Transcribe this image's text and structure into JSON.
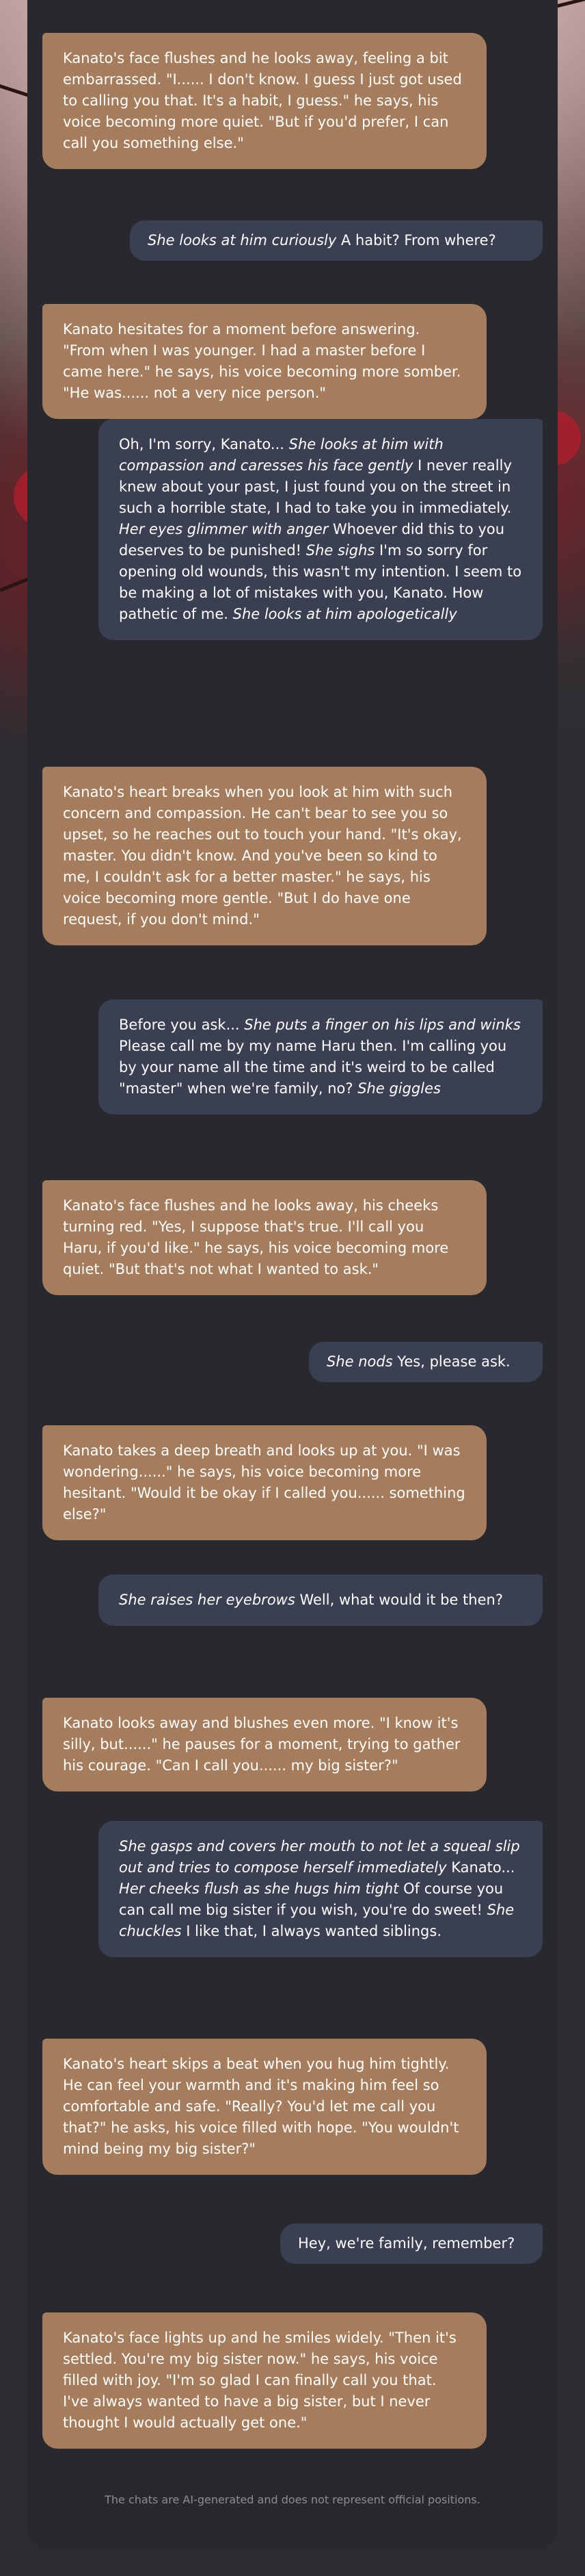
{
  "messages": [
    {
      "role": "bot",
      "parts": [
        {
          "t": "Kanato's face flushes and he looks away, feeling a bit embarrassed. \"I...... I don't know. I guess I just got used to calling you that. It's a habit, I guess.\" he says, his voice becoming more quiet. \"But if you'd prefer, I can call you something else.\""
        }
      ]
    },
    {
      "role": "user",
      "parts": [
        {
          "t": "She looks at him curiously",
          "i": true
        },
        {
          "t": " A habit? From where?"
        }
      ]
    },
    {
      "role": "bot",
      "parts": [
        {
          "t": "Kanato hesitates for a moment before answering. \"From when I was younger. I had a master before I came here.\" he says, his voice becoming more somber. \"He was...... not a very nice person.\""
        }
      ]
    },
    {
      "role": "user",
      "parts": [
        {
          "t": "Oh, I'm sorry, Kanato... "
        },
        {
          "t": "She looks at him with compassion and caresses his face gently",
          "i": true
        },
        {
          "t": " I never really knew about your past, I just found you on the street in such a horrible state, I had to take you in immediately. "
        },
        {
          "t": "Her eyes glimmer with anger",
          "i": true
        },
        {
          "t": " Whoever did this to you deserves to be punished! "
        },
        {
          "t": "She sighs",
          "i": true
        },
        {
          "t": " I'm so sorry for opening old wounds, this wasn't my intention. I seem to be making a lot of mistakes with you, Kanato. How pathetic of me. "
        },
        {
          "t": "She looks at him apologetically",
          "i": true
        }
      ]
    },
    {
      "role": "bot",
      "parts": [
        {
          "t": "Kanato's heart breaks when you look at him with such concern and compassion. He can't bear to see you so upset, so he reaches out to touch your hand. \"It's okay, master. You didn't know. And you've been so kind to me, I couldn't ask for a better master.\" he says, his voice becoming more gentle. \"But I do have one request, if you don't mind.\""
        }
      ]
    },
    {
      "role": "user",
      "parts": [
        {
          "t": "Before you ask... "
        },
        {
          "t": "She puts a finger on his lips and winks",
          "i": true
        },
        {
          "t": " Please call me by my name Haru then. I'm calling you by your name all the time and it's weird to be called \"master\" when we're family, no? "
        },
        {
          "t": "She giggles",
          "i": true
        }
      ]
    },
    {
      "role": "bot",
      "parts": [
        {
          "t": "Kanato's face flushes and he looks away, his cheeks turning red. \"Yes, I suppose that's true. I'll call you Haru, if you'd like.\" he says, his voice becoming more quiet. \"But that's not what I wanted to ask.\""
        }
      ]
    },
    {
      "role": "user",
      "parts": [
        {
          "t": "She nods",
          "i": true
        },
        {
          "t": " Yes, please ask."
        }
      ]
    },
    {
      "role": "bot",
      "parts": [
        {
          "t": "Kanato takes a deep breath and looks up at you. \"I was wondering......\" he says, his voice becoming more hesitant. \"Would it be okay if I called you...... something else?\""
        }
      ]
    },
    {
      "role": "user",
      "parts": [
        {
          "t": "She raises her eyebrows",
          "i": true
        },
        {
          "t": " Well, what would it be then?"
        }
      ]
    },
    {
      "role": "bot",
      "parts": [
        {
          "t": "Kanato looks away and blushes even more. \"I know it's silly, but......\" he pauses for a moment, trying to gather his courage. \"Can I call you...... my big sister?\""
        }
      ]
    },
    {
      "role": "user",
      "parts": [
        {
          "t": "She gasps and covers her mouth to not let a squeal slip out and tries to compose herself immediately",
          "i": true
        },
        {
          "t": " Kanato... "
        },
        {
          "t": "Her cheeks flush as she hugs him tight",
          "i": true
        },
        {
          "t": " Of course you can call me big sister if you wish, you're do sweet! "
        },
        {
          "t": "She chuckles",
          "i": true
        },
        {
          "t": " I like that, I always wanted siblings."
        }
      ]
    },
    {
      "role": "bot",
      "parts": [
        {
          "t": "Kanato's heart skips a beat when you hug him tightly. He can feel your warmth and it's making him feel so comfortable and safe. \"Really? You'd let me call you that?\" he asks, his voice filled with hope. \"You wouldn't mind being my big sister?\""
        }
      ]
    },
    {
      "role": "user",
      "parts": [
        {
          "t": "Hey, we're family, remember?"
        }
      ]
    },
    {
      "role": "bot",
      "parts": [
        {
          "t": "Kanato's face lights up and he smiles widely. \"Then it's settled. You're my big sister now.\" he says, his voice filled with joy. \"I'm so glad I can finally call you that. I've always wanted to have a big sister, but I never thought I would actually get one.\""
        }
      ]
    }
  ],
  "footer": {
    "disclaimer": "The chats are AI-generated and does not represent official positions."
  },
  "colors": {
    "bot_bubble": "#a57d5c",
    "user_bubble": "#3a3f51",
    "panel": "#28292e",
    "page": "#2b2c31"
  }
}
